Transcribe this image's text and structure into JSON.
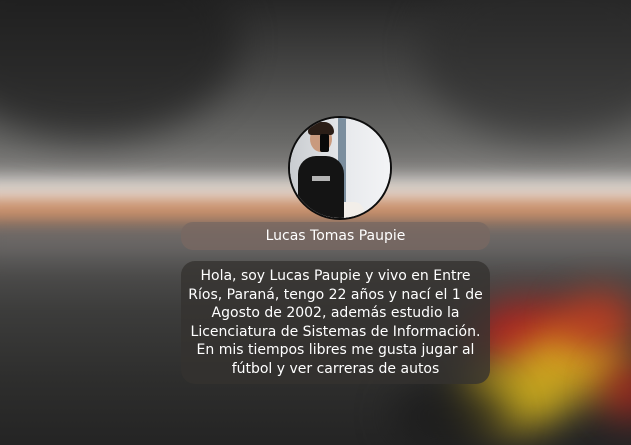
{
  "profile": {
    "name": "Lucas Tomas Paupie",
    "bio": "Hola, soy Lucas Paupie y vivo en Entre Ríos, Paraná, tengo 22 años y nací el 1 de Agosto de 2002, además estudio la Licenciatura de Sistemas de Información. En mis tiempos libres me gusta jugar al fútbol y ver carreras de autos",
    "avatar_icon": "profile-photo"
  },
  "colors": {
    "name_pill_bg": "#786862",
    "bio_card_bg": "#343230",
    "text": "#ffffff"
  }
}
